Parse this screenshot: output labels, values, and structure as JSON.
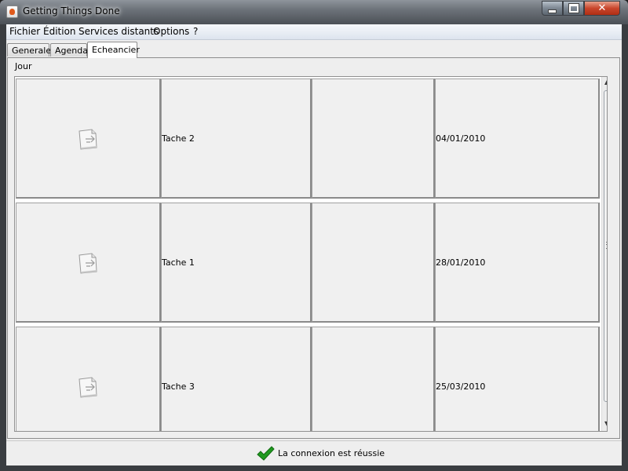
{
  "window": {
    "title": "Getting Things Done"
  },
  "title_buttons": {
    "minimize": "minimize-icon",
    "maximize": "maximize-icon",
    "close": "✕"
  },
  "menu": [
    {
      "label": "Fichier"
    },
    {
      "label": "Édition"
    },
    {
      "label": "Services distants"
    },
    {
      "label": "Options"
    },
    {
      "label": "?"
    }
  ],
  "tabs": [
    {
      "label": "Generale"
    },
    {
      "label": "Agenda"
    },
    {
      "label": "Echeancier",
      "selected": true
    }
  ],
  "panel": {
    "header": "Jour"
  },
  "rows": [
    {
      "icon": "document-arrow-icon",
      "task": "Tache 2",
      "empty": "",
      "date": "04/01/2010"
    },
    {
      "icon": "document-arrow-icon",
      "task": "Tache 1",
      "empty": "",
      "date": "28/01/2010"
    },
    {
      "icon": "document-arrow-icon",
      "task": "Tache 3",
      "empty": "",
      "date": "25/03/2010"
    }
  ],
  "status": {
    "icon": "check-icon",
    "text": "La connexion est réussie",
    "icon_color": "#1f9a1f"
  }
}
